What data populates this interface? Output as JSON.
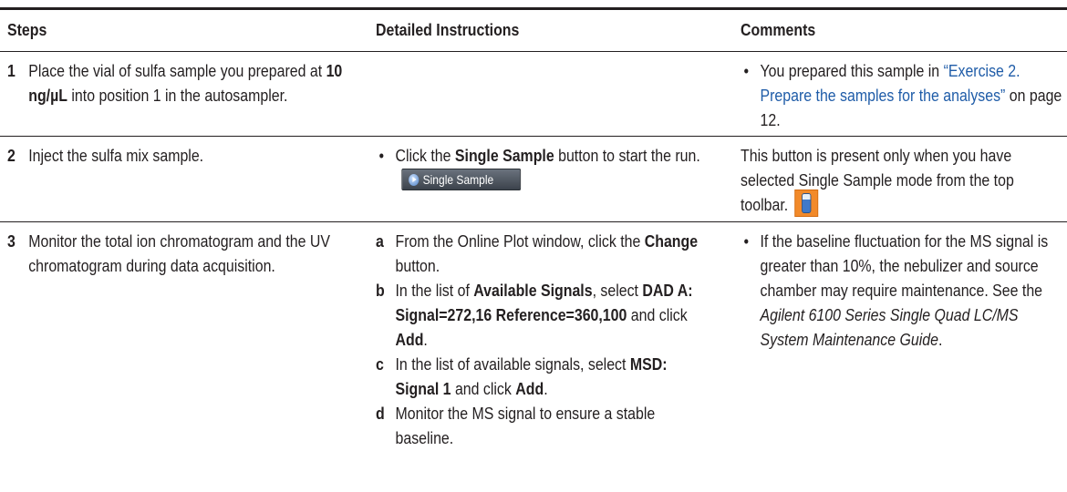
{
  "headers": {
    "steps": "Steps",
    "instructions": "Detailed Instructions",
    "comments": "Comments"
  },
  "rows": [
    {
      "number": "1",
      "step_pre": "Place the vial of sulfa sample you prepared at ",
      "step_bold": "10 ng/µL",
      "step_post": " into position 1 in the autosampler.",
      "comment_bullet": "•",
      "comment_pre": "You prepared this sample in ",
      "comment_link": "“Exercise 2. Prepare the samples for the analyses”",
      "comment_post": " on page 12."
    },
    {
      "number": "2",
      "step": "Inject the sulfa mix sample.",
      "instr_bullet": "•",
      "instr_pre": "Click the ",
      "instr_bold": "Single Sample",
      "instr_post": " button to start the run.",
      "button_image_label": "Single Sample",
      "button_image_icon": "play-icon",
      "comment": "This button is present only when you have selected Single Sample mode from the top toolbar.",
      "toolbar_icon": "vial-icon"
    },
    {
      "number": "3",
      "step": "Monitor the total ion chromatogram and the UV chromatogram during data acquisition.",
      "substeps": [
        {
          "letter": "a",
          "pre": "From the Online Plot window, click the ",
          "bold": "Change",
          "post": " button."
        },
        {
          "letter": "b",
          "pre": "In the list of ",
          "bold1": "Available Signals",
          "mid1": ", select ",
          "bold2": "DAD A: Signal=272,16 Reference=360,100",
          "mid2": " and click ",
          "bold3": "Add",
          "post": "."
        },
        {
          "letter": "c",
          "pre": "In the list of available signals, select ",
          "bold1": "MSD: Signal 1",
          "mid": " and click ",
          "bold2": "Add",
          "post": "."
        },
        {
          "letter": "d",
          "text": "Monitor the MS signal to ensure a stable baseline."
        }
      ],
      "comment_bullet": "•",
      "comment_pre": "If the baseline fluctuation for the MS signal is greater than 10%, the nebulizer and source chamber may require maintenance. See the ",
      "comment_italic": "Agilent 6100 Series Single Quad LC/MS System Maintenance Guide",
      "comment_post": "."
    }
  ],
  "colors": {
    "text": "#231f20",
    "link": "#1f5ca8",
    "toolbar_icon_bg": "#f28a2a"
  }
}
